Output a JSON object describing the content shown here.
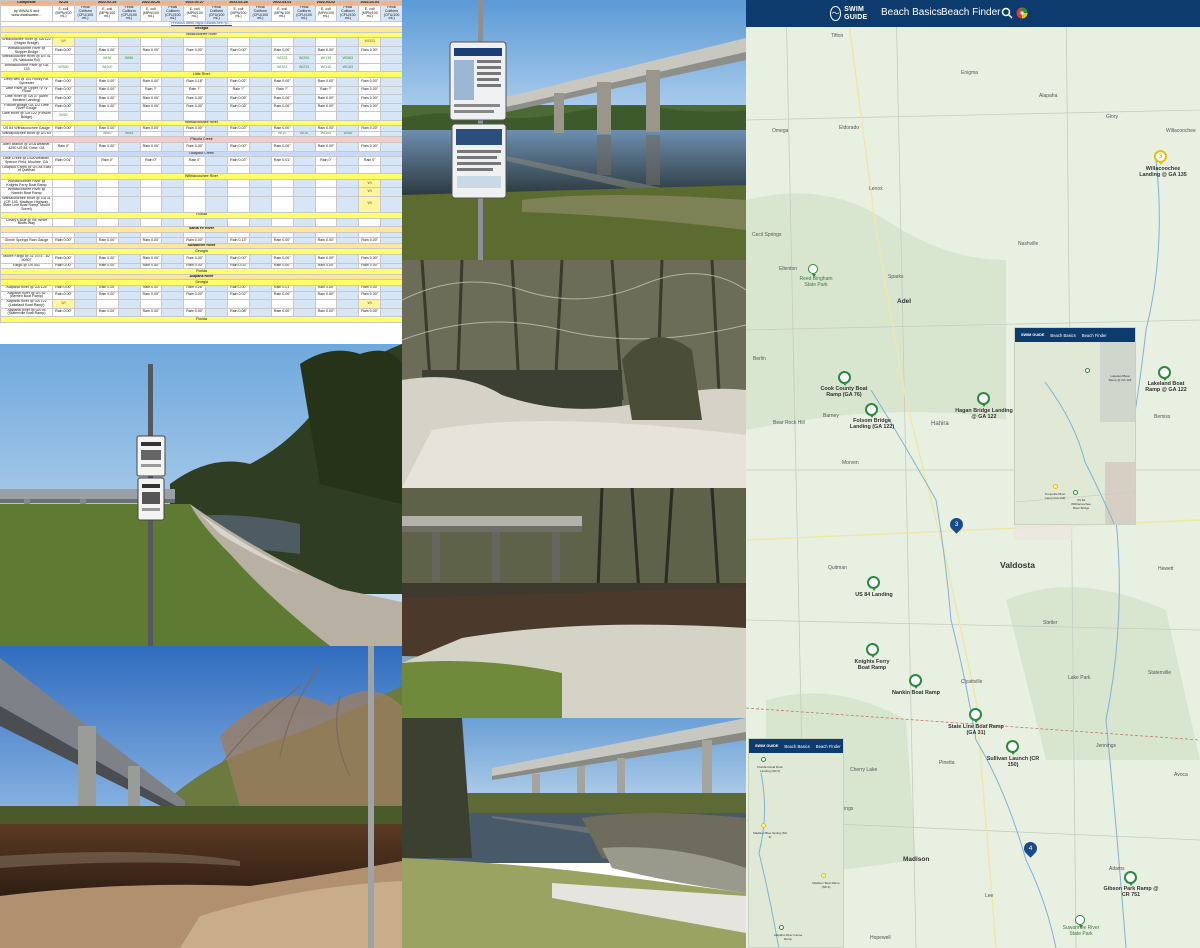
{
  "sheet": {
    "top_row": [
      "Composite",
      "02-24",
      "",
      "2022-02-25",
      "",
      "2022-02-26",
      "",
      "2022-02-27",
      "",
      "2022-02-28",
      "",
      "2022-03-01",
      "",
      "2022-03-02",
      "",
      "2022-03-03",
      ""
    ],
    "header_row": [
      "by WWALS and www.wwalswater...",
      "E. coli (MPN/100 mL)",
      "Fecal Coliform (CFU/100 mL)",
      "E. coli (MPN/100 mL)",
      "Fecal Coliform (CFU/100 mL)",
      "E. coli (MPN/100 mL)",
      "Fecal Coliform (CFU/100 mL)",
      "E. coli (MPN/100 mL)",
      "Fecal Coliform (CFU/100 mL)",
      "E. coli (MPN/100 mL)",
      "Fecal Coliform (CFU/100 mL)",
      "E. coli (MPN/100 mL)",
      "Fecal Coliform (CFU/100 mL)",
      "E. coli (MPN/100 mL)",
      "Fecal Coliform (CFU/100 mL)",
      "E. coli (MPN/100 mL)",
      "Fecal Coliform (CFU/100 mL)"
    ],
    "link_row": "Previous week https://wwals.net/?p=...",
    "rows": [
      {
        "style": "sec",
        "cells": [
          "Georgia"
        ]
      },
      {
        "style": "yl",
        "cells": [
          "Willacoochee River"
        ]
      },
      {
        "style": "",
        "cells": [
          "Willacoochee River @ GA 122 (Hagan Bridge)",
          "WI",
          "",
          "",
          "",
          "",
          "",
          "",
          "",
          "",
          "",
          "",
          "",
          "",
          "",
          "WI333",
          ""
        ]
      },
      {
        "style": "",
        "cells": [
          "Withlacoochee River @ Skipper Bridge",
          "Rain 0.00\"",
          "",
          "Rain 0.00\"",
          "",
          "Rain 0.00\"",
          "",
          "Rain 0.00\"",
          "",
          "Rain 0.00\"",
          "",
          "Rain 0.00\"",
          "",
          "Rain 0.00\"",
          "",
          "Rain 0.00\"",
          ""
        ]
      },
      {
        "style": "",
        "cells": [
          "Withlacoochee River @ US 41 (N. Valdosta Rd)",
          "",
          "",
          "WI36",
          "WI66",
          "",
          "",
          "",
          "",
          "",
          "",
          "WI333",
          "WI200",
          "WI136",
          "WI363",
          "",
          ""
        ]
      },
      {
        "style": "",
        "cells": [
          "Withlacoochee River @ GA 133",
          "WI350",
          "",
          "WI200",
          "",
          "",
          "",
          "",
          "",
          "",
          "",
          "WI323",
          "WI233",
          "WI140",
          "WI183",
          "",
          ""
        ]
      },
      {
        "style": "yl",
        "cells": [
          "Little River"
        ]
      },
      {
        "style": "",
        "cells": [
          "Deep well @ 153 Rocky Rd. Sylvester",
          "Rain 0.00\"",
          "",
          "Rain 0.00\"",
          "",
          "Rain 0.00\"",
          "",
          "Rain 0.18\"",
          "",
          "Rain 0.02\"",
          "",
          "Rain 0.00\"",
          "",
          "Rain 0.00\"",
          "",
          "Rain 0.00\"",
          ""
        ]
      },
      {
        "style": "",
        "cells": [
          "Little River @ Upper Ty Ty Road",
          "Rain 0.00\"",
          "",
          "Rain 0.00\"",
          "",
          "Rain ?\"",
          "",
          "Rain ?\"",
          "",
          "Rain ?\"",
          "",
          "Rain ?\"",
          "",
          "Rain ?\"",
          "",
          "Rain 0.00\"",
          ""
        ]
      },
      {
        "style": "",
        "cells": [
          "Little River @ GA 37 (Allen Moultrie Landing)",
          "Rain 0.00\"",
          "",
          "Rain 0.00\"",
          "",
          "Rain 0.00\"",
          "",
          "Rain 0.00\"",
          "",
          "Rain 0.05\"",
          "",
          "Rain 0.00\"",
          "",
          "Rain 0.00\"",
          "",
          "Rain 0.00\"",
          ""
        ]
      },
      {
        "style": "",
        "cells": [
          "Folsom Bridge GA 122 Little River Gauge",
          "Rain 0.00\"",
          "",
          "Rain 0.00\"",
          "",
          "Rain 0.00\"",
          "",
          "Rain 0.00\"",
          "",
          "Rain 0.03\"",
          "",
          "Rain 0.00\"",
          "",
          "Rain 0.00\"",
          "",
          "Rain 0.00\"",
          ""
        ]
      },
      {
        "style": "",
        "cells": [
          "Little River @ GA 122 (Folsom Bridge)",
          "WI30",
          "",
          "",
          "",
          "",
          "",
          "",
          "",
          "",
          "",
          "",
          "",
          "",
          "",
          "",
          ""
        ]
      },
      {
        "style": "yl",
        "cells": [
          "Withlacoochee River"
        ]
      },
      {
        "style": "",
        "cells": [
          "US 84 Withlacoochee Gauge",
          "Rain 0.00\"",
          "",
          "Rain 0.00\"",
          "",
          "Rain 0.00\"",
          "",
          "Rain 0.00\"",
          "",
          "Rain 0.03\"",
          "",
          "Rain 0.00\"",
          "",
          "Rain 0.00\"",
          "",
          "Rain 0.00\"",
          ""
        ]
      },
      {
        "style": "",
        "cells": [
          "Withlacoochee River @ US 84",
          "",
          "",
          "WI60",
          "WI84",
          "",
          "",
          "",
          "",
          "",
          "",
          "WI10",
          "WI30",
          "WI105",
          "WI66",
          "",
          ""
        ]
      },
      {
        "style": "pk",
        "cells": [
          "Piscola Creek"
        ]
      },
      {
        "style": "",
        "cells": [
          "Allen Branch @ USA weather, 4250 US 84, Dixie, GA",
          "Rain 0\"",
          "",
          "Rain 0.00\"",
          "",
          "Rain 0.00\"",
          "",
          "Rain 0.00\"",
          "",
          "Rain 0.00\"",
          "",
          "Rain 0.00\"",
          "",
          "Rain 0.00\"",
          "",
          "Rain 0.00\"",
          ""
        ]
      },
      {
        "style": "lb",
        "cells": [
          "Okapilco Creek"
        ]
      },
      {
        "style": "",
        "cells": [
          "Little Creek @ USA Weather, Spence Field, Moultrie, GA",
          "Rain 0.01\"",
          "",
          "Rain 0\"",
          "",
          "Rain 0\"",
          "",
          "Rain 0\"",
          "",
          "Rain 0.03\"",
          "",
          "Rain 0.01\"",
          "",
          "Rain 0\"",
          "",
          "Rain 0\"",
          ""
        ]
      },
      {
        "style": "",
        "cells": [
          "Okapilco Creek @ US 84 East of Quitman",
          "",
          "",
          "",
          "",
          "",
          "",
          "",
          "",
          "",
          "",
          "",
          "",
          "",
          "",
          "",
          ""
        ]
      },
      {
        "style": "yl",
        "cells": [
          "Withlacoochee River"
        ]
      },
      {
        "style": "",
        "cells": [
          "Withlacoochee River @ Knights Ferry Boat Ramp",
          "",
          "",
          "",
          "",
          "",
          "",
          "",
          "",
          "",
          "",
          "",
          "",
          "",
          "",
          "WI",
          ""
        ]
      },
      {
        "style": "",
        "cells": [
          "Withlacoochee River @ Nankin Boat Ramp",
          "",
          "",
          "",
          "",
          "",
          "",
          "",
          "",
          "",
          "",
          "",
          "",
          "",
          "",
          "WI",
          ""
        ]
      },
      {
        "style": "",
        "cells": [
          "Withlacoochee River @ GA 31 (CR 145, Madison Highway, State Line Boat Ramp, Mount Sorrel)",
          "",
          "",
          "",
          "",
          "",
          "",
          "",
          "",
          "",
          "",
          "",
          "",
          "",
          "",
          "WI",
          ""
        ]
      },
      {
        "style": "yl",
        "cells": [
          "Florida"
        ]
      },
      {
        "style": "",
        "cells": [
          "Cleary's bluff @ NE White Bluffs Way",
          "",
          "",
          "",
          "",
          "",
          "",
          "",
          "",
          "",
          "",
          "",
          "",
          "",
          "",
          "",
          ""
        ]
      },
      {
        "style": "sec",
        "cells": [
          "Santa Fe River"
        ]
      },
      {
        "style": "",
        "cells": [
          "",
          "",
          "",
          "",
          "",
          "",
          "",
          "",
          "",
          "",
          "",
          "",
          "",
          "",
          "",
          "",
          ""
        ]
      },
      {
        "style": "",
        "cells": [
          "Ginnie Springs Rain Gauge",
          "Rain 0.00\"",
          "",
          "Rain 0.00\"",
          "",
          "Rain 0.00\"",
          "",
          "Rain 0.00\"",
          "",
          "Rain 0.13\"",
          "",
          "Rain 0.00\"",
          "",
          "Rain 0.00\"",
          "",
          "Rain 0.00\"",
          ""
        ]
      },
      {
        "style": "sec",
        "cells": [
          "Suwannee River"
        ]
      },
      {
        "style": "yl",
        "cells": [
          "Georgia"
        ]
      },
      {
        "style": "",
        "cells": [
          "Moore Fargo @ 31 7575 - 82 50507",
          "Rain 0.00\"",
          "",
          "Rain 0.00\"",
          "",
          "Rain 0.00\"",
          "",
          "Rain 0.00\"",
          "",
          "Rain 0.00\"",
          "",
          "Rain 0.00\"",
          "",
          "Rain 0.00\"",
          "",
          "Rain 0.00\"",
          ""
        ]
      },
      {
        "style": "",
        "cells": [
          "Fargo @ US 441",
          "Rain 0.00\"",
          "",
          "Rain 0.00\"",
          "",
          "Rain 0.00\"",
          "",
          "Rain 0.00\"",
          "",
          "Rain 0.03\"",
          "",
          "Rain 0.00\"",
          "",
          "Rain 0.00\"",
          "",
          "Rain 0.00\"",
          ""
        ]
      },
      {
        "style": "yl",
        "cells": [
          "Florida"
        ]
      },
      {
        "style": "sec",
        "cells": [
          "Alapaha River"
        ]
      },
      {
        "style": "yl",
        "cells": [
          "Georgia"
        ]
      },
      {
        "style": "",
        "cells": [
          "Alapaha River @ GA 125",
          "Rain 0.00\"",
          "",
          "Rain 0.00\"",
          "",
          "Rain 0.00\"",
          "",
          "Rain 0.26\"",
          "",
          "Rain 0.00\"",
          "",
          "Rain 0.01\"",
          "",
          "Rain 0.00\"",
          "",
          "Rain 0.00\"",
          ""
        ]
      },
      {
        "style": "",
        "cells": [
          "Alapaha River @ US 82 (Berrien Boat Ramp)",
          "Rain 0.00\"",
          "",
          "Rain 0.00\"",
          "",
          "Rain 0.00\"",
          "",
          "Rain 0.00\"",
          "",
          "Rain 0.02\"",
          "",
          "Rain 0.00\"",
          "",
          "Rain 0.00\"",
          "",
          "Rain 0.00\"",
          ""
        ]
      },
      {
        "style": "",
        "cells": [
          "Alapaha River @ GA 122 (Lakeland Boat Ramp)",
          "WI",
          "",
          "",
          "",
          "",
          "",
          "",
          "",
          "",
          "",
          "",
          "",
          "",
          "",
          "WI",
          ""
        ]
      },
      {
        "style": "",
        "cells": [
          "Alapaha River @ GA 94 (Statenville Boat Ramp)",
          "Rain 0.00\"",
          "",
          "Rain 0.00\"",
          "",
          "Rain 0.00\"",
          "",
          "Rain 0.00\"",
          "",
          "Rain 0.08\"",
          "",
          "Rain 0.00\"",
          "",
          "Rain 0.00\"",
          "",
          "Rain 0.00\"",
          ""
        ]
      },
      {
        "style": "yl",
        "cells": [
          "Florida"
        ]
      }
    ]
  },
  "photos": [
    {
      "name": "photo-bridge-sign-reflection",
      "scene": "bridge"
    },
    {
      "name": "photo-sign-sandy-bank",
      "scene": "signbank"
    },
    {
      "name": "photo-forest-sandbar",
      "scene": "forest"
    },
    {
      "name": "photo-old-bridge-river",
      "scene": "oldbridge"
    },
    {
      "name": "photo-highway-bridge-river",
      "scene": "highway"
    },
    {
      "name": "photo-bridge-boat-ramp",
      "scene": "ramp"
    }
  ],
  "map": {
    "nav": {
      "brand": "SWIM GUIDE",
      "basics": "Beach Basics",
      "finder": "Beach Finder"
    },
    "icons": {
      "search": "search-icon",
      "flag": "language-flag-icon",
      "logo": "wave-logo-icon"
    },
    "colors": {
      "header": "#0d3b6e",
      "good": "#2a8a3e",
      "caution": "#e6c20a",
      "cluster": "#1a4a8a"
    },
    "towns": [
      "Tifton",
      "Enigma",
      "Alapaha",
      "Glory",
      "Willacoochee",
      "Omega",
      "Eldorado",
      "Lenox",
      "Cecil Springs",
      "Nashville",
      "Ellenton",
      "Sparks",
      "Adel",
      "Berlin",
      "Barney",
      "Hahira",
      "Bemiss",
      "Morven",
      "Quitman",
      "Valdosta",
      "Hewett",
      "Stetler",
      "Clyattville",
      "Lake Park",
      "Statenville",
      "Pinetta",
      "Jennings",
      "Cherry Lake",
      "Blue Springs",
      "Madison",
      "Lee",
      "Adams",
      "Hopewell",
      "Avoca",
      "Bear Rock Hill"
    ],
    "pins": [
      {
        "label": "Willacoochee Landing @ GA 135",
        "status": "caution",
        "num": "3"
      },
      {
        "label": "Reed Bingham State Park",
        "status": "good",
        "num": ""
      },
      {
        "label": "Cook County Boat Ramp (GA 76)",
        "status": "good",
        "num": ""
      },
      {
        "label": "Folsom Bridge Landing (GA 122)",
        "status": "good",
        "num": ""
      },
      {
        "label": "Hagan Bridge Landing @ GA 122",
        "status": "good",
        "num": ""
      },
      {
        "label": "Lakeland Boat Ramp @ GA 122",
        "status": "good",
        "num": ""
      },
      {
        "label": "US 84 Landing",
        "status": "good",
        "num": ""
      },
      {
        "label": "Knights Ferry Boat Ramp",
        "status": "good",
        "num": ""
      },
      {
        "label": "Nankin Boat Ramp",
        "status": "good",
        "num": ""
      },
      {
        "label": "State Line Boat Ramp (GA 31)",
        "status": "good",
        "num": ""
      },
      {
        "label": "Sullivan Launch (CR 150)",
        "status": "good",
        "num": ""
      },
      {
        "label": "Gibson Park Ramp @ CR 751",
        "status": "good",
        "num": ""
      },
      {
        "label": "Suwannee River State Park",
        "status": "good",
        "num": ""
      }
    ],
    "clusters": [
      "3",
      "4"
    ],
    "inset_a": {
      "nav": {
        "brand": "SWIM GUIDE",
        "basics": "Beach Basics",
        "finder": "Beach Finder"
      },
      "labels": [
        "Lakeland Boat Ramp @ GA 122",
        "Troupville River Camp (GA 133)",
        "US 84 Withlacoochee River Bridge"
      ]
    },
    "inset_b": {
      "nav": {
        "brand": "SWIM GUIDE",
        "basics": "Beach Basics",
        "finder": "Beach Finder"
      },
      "labels": [
        "Florida Canal Rock Landing (SR 6)",
        "Madison Blue Spring (SR 6)",
        "Madison Boat Ramp (SR 6)",
        "Alapaha River Canoe Ramp"
      ]
    }
  }
}
